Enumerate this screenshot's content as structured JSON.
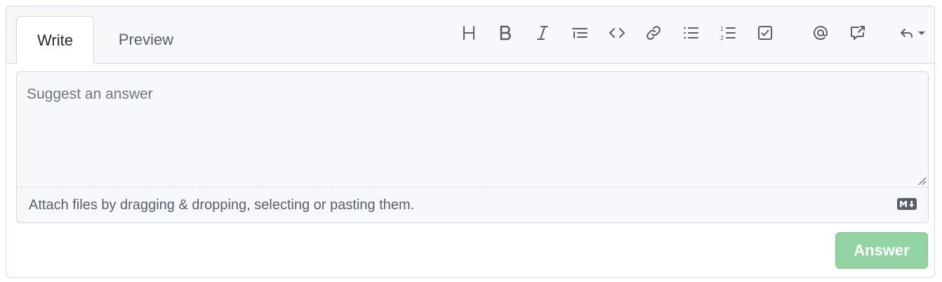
{
  "tabs": {
    "write_label": "Write",
    "preview_label": "Preview",
    "active": "Write"
  },
  "toolbar": {
    "icons": [
      "heading-icon",
      "bold-icon",
      "italic-icon",
      "quote-icon",
      "code-icon",
      "link-icon",
      "bulleted-list-icon",
      "numbered-list-icon",
      "task-list-icon",
      "mention-icon",
      "cross-reference-icon",
      "reply-icon"
    ]
  },
  "editor": {
    "placeholder": "Suggest an answer",
    "value": "",
    "attach_text": "Attach files by dragging & dropping, selecting or pasting them."
  },
  "submit": {
    "label": "Answer",
    "disabled": true,
    "color": "#94d3a2"
  },
  "colors": {
    "border": "#d0d7de",
    "header_bg": "#f6f8fa",
    "icon": "#57606a",
    "text": "#24292f"
  }
}
